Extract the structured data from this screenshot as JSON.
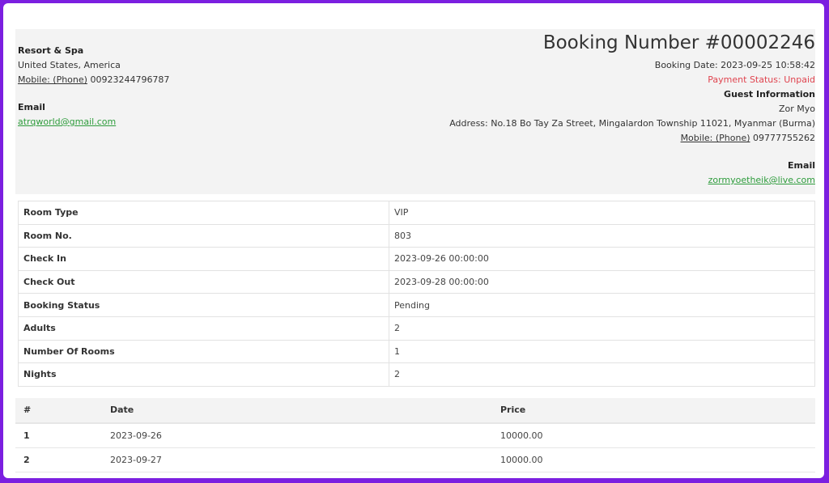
{
  "hotel": {
    "name": "Resort & Spa",
    "location": "United States, America",
    "mobile_label": "Mobile: (Phone)",
    "mobile_value": "00923244796787",
    "email_label": "Email",
    "email_value": "atrqworld@gmail.com"
  },
  "booking": {
    "title": "Booking Number #00002246",
    "date_line": "Booking Date: 2023-09-25 10:58:42",
    "payment_status": "Payment Status: Unpaid"
  },
  "guest": {
    "heading": "Guest Information",
    "name": "Zor Myo",
    "address": "Address: No.18 Bo Tay Za Street, Mingalardon Township 11021, Myanmar (Burma)",
    "mobile_label": "Mobile: (Phone)",
    "mobile_value": "09777755262",
    "email_label": "Email",
    "email_value": "zormyoetheik@live.com"
  },
  "details": [
    {
      "label": "Room Type",
      "value": "VIP"
    },
    {
      "label": "Room No.",
      "value": "803"
    },
    {
      "label": "Check In",
      "value": "2023-09-26 00:00:00"
    },
    {
      "label": "Check Out",
      "value": "2023-09-28 00:00:00"
    },
    {
      "label": "Booking Status",
      "value": "Pending"
    },
    {
      "label": "Adults",
      "value": "2"
    },
    {
      "label": "Number Of Rooms",
      "value": "1"
    },
    {
      "label": "Nights",
      "value": "2"
    }
  ],
  "prices": {
    "headers": [
      "#",
      "Date",
      "Price"
    ],
    "rows": [
      {
        "num": "1",
        "date": "2023-09-26",
        "price": "10000.00"
      },
      {
        "num": "2",
        "date": "2023-09-27",
        "price": "10000.00"
      }
    ]
  },
  "colors": {
    "frame": "#7b1fe0",
    "link": "#2e9c3c",
    "unpaid": "#e0444f"
  }
}
